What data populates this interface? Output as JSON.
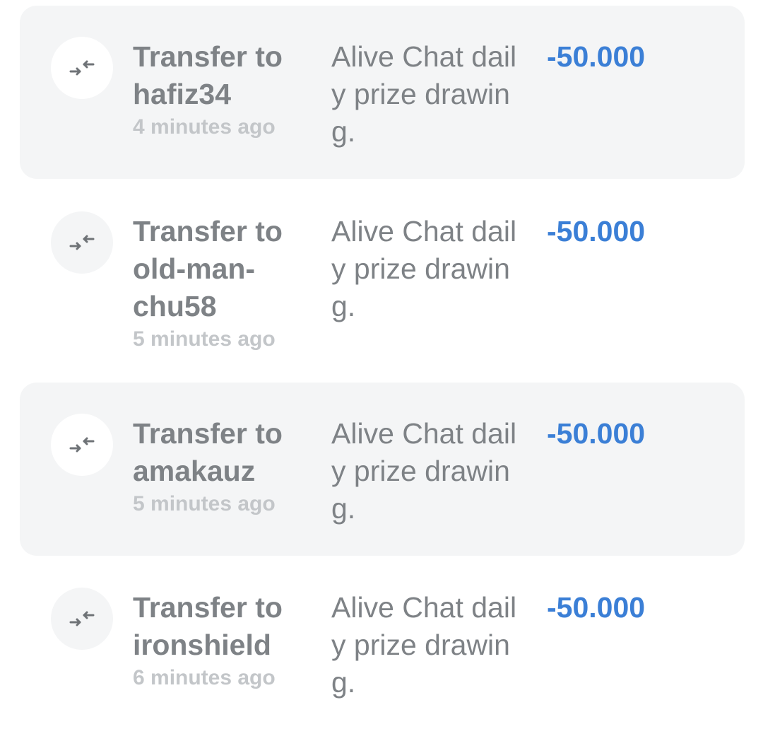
{
  "transactions": [
    {
      "icon": "transfer-arrows-icon",
      "title": "Transfer to hafiz34",
      "time": "4 minutes ago",
      "memo": "Alive Chat daily prize drawing.",
      "amount": "-50.000"
    },
    {
      "icon": "transfer-arrows-icon",
      "title": "Transfer to old-man-chu58",
      "time": "5 minutes ago",
      "memo": "Alive Chat daily prize drawing.",
      "amount": "-50.000"
    },
    {
      "icon": "transfer-arrows-icon",
      "title": "Transfer to amakauz",
      "time": "5 minutes ago",
      "memo": "Alive Chat daily prize drawing.",
      "amount": "-50.000"
    },
    {
      "icon": "transfer-arrows-icon",
      "title": "Transfer to ironshield",
      "time": "6 minutes ago",
      "memo": "Alive Chat daily prize drawing.",
      "amount": "-50.000"
    }
  ],
  "colors": {
    "amount": "#3b7fd6",
    "row_shaded_bg": "#f4f5f6",
    "title_text": "#7e8286",
    "time_text": "#c3c6c9"
  }
}
